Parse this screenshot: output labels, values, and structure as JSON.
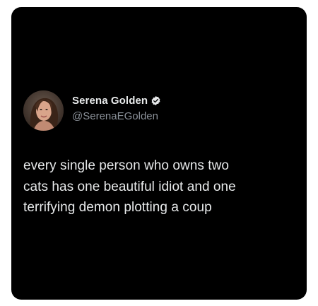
{
  "tweet": {
    "author": {
      "display_name": "Serena Golden",
      "handle": "@SerenaEGolden",
      "verified": true,
      "avatar_icon": "profile-photo"
    },
    "text_lines": [
      "every single person who owns two",
      "cats has one beautiful idiot and one",
      "terrifying demon plotting a coup"
    ]
  },
  "colors": {
    "card_background": "#000000",
    "page_background": "#ffffff",
    "primary_text": "#e7e9ea",
    "secondary_text": "#8b9199",
    "verified_badge": "#e7e9ea"
  }
}
